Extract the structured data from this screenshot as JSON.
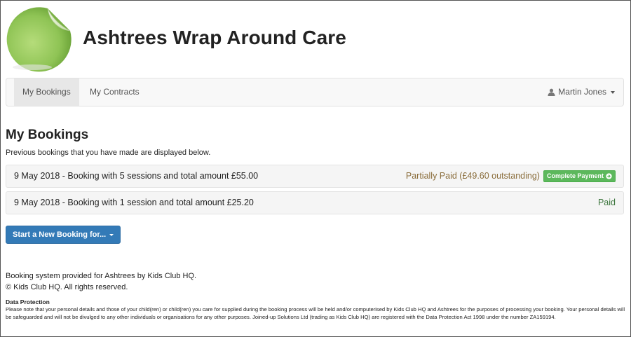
{
  "header": {
    "site_title": "Ashtrees Wrap Around Care"
  },
  "nav": {
    "items": [
      {
        "label": "My Bookings",
        "active": true
      },
      {
        "label": "My Contracts",
        "active": false
      }
    ],
    "user_name": "Martin Jones",
    "user_icon": "user-icon"
  },
  "main": {
    "title": "My Bookings",
    "subtitle": "Previous bookings that you have made are displayed below.",
    "bookings": [
      {
        "description": "9 May 2018 - Booking with 5 sessions and total amount £55.00",
        "status": "Partially Paid (£49.60 outstanding)",
        "action_label": "Complete Payment"
      },
      {
        "description": "9 May 2018 - Booking with 1 session and total amount £25.20",
        "status": "Paid"
      }
    ],
    "new_booking_label": "Start a New Booking for..."
  },
  "footer": {
    "provided_by": "Booking system provided for Ashtrees by Kids Club HQ.",
    "copyright": "© Kids Club HQ. All rights reserved.",
    "data_protection_heading": "Data Protection",
    "data_protection_text": "Please note that your personal details and those of your child(ren) or child(ren) you care for supplied during the booking process will be held and/or computerised by Kids Club HQ and Ashtrees for the purposes of processing your booking. Your personal details will be safeguarded and will not be divulged to any other individuals or organisations for any other purposes. Joined-up Solutions Ltd (trading as Kids Club HQ) are registered with the Data Protection Act 1998 under the number ZA159194."
  },
  "colors": {
    "logo_green": "#9ccc65",
    "primary_button": "#337ab7",
    "success_button": "#5cb85c",
    "partial_status": "#8a6d3b",
    "paid_status": "#3c763d"
  }
}
